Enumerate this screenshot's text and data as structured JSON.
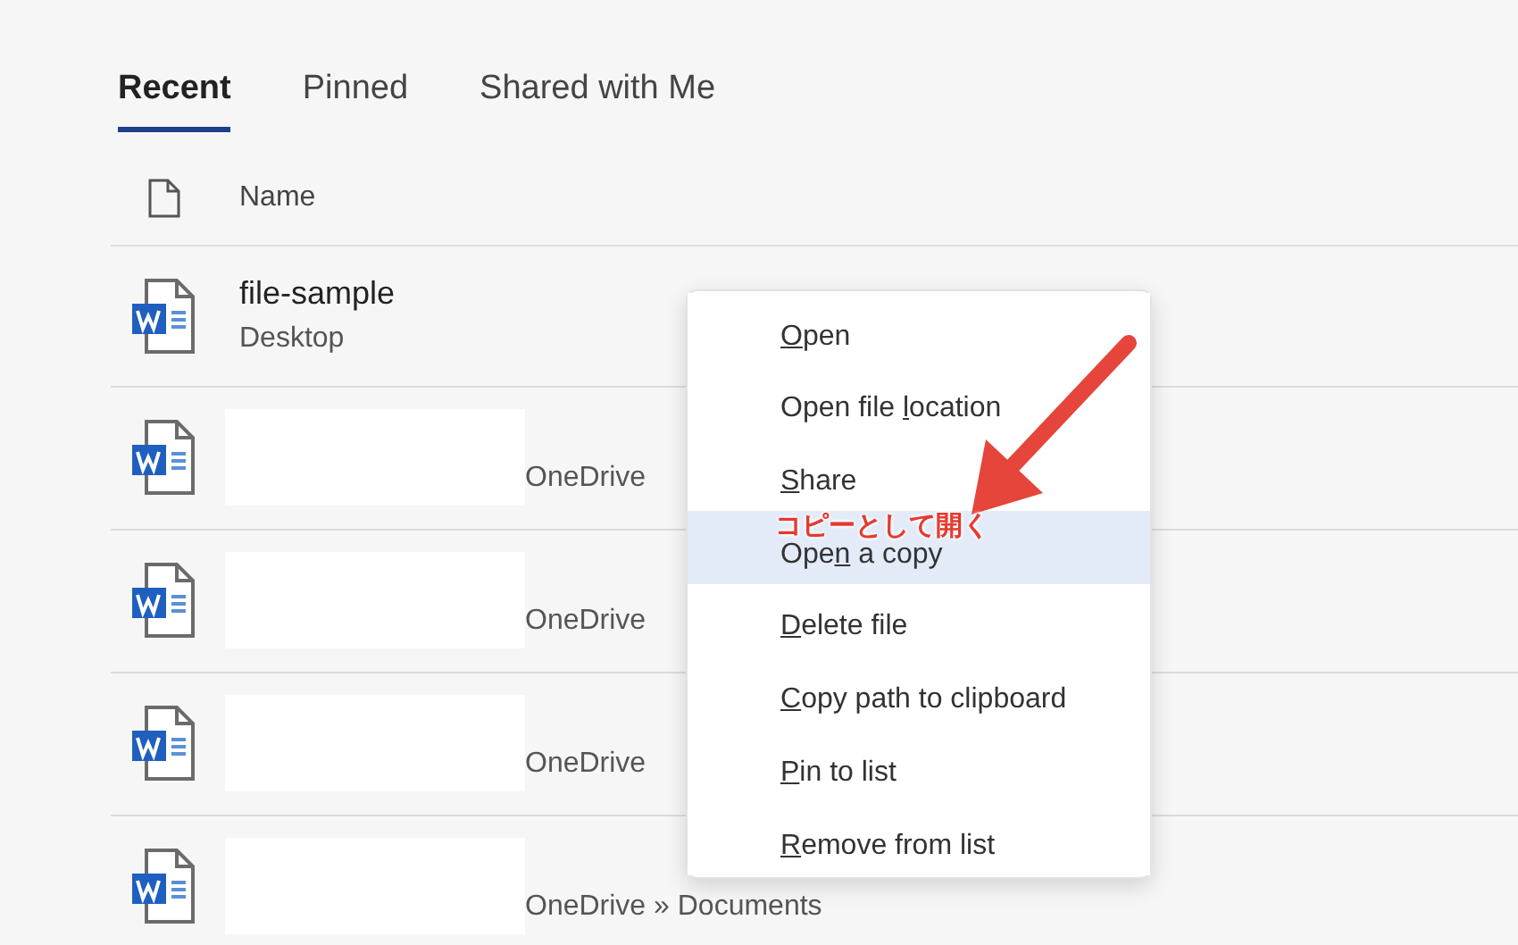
{
  "tabs": [
    {
      "label": "Recent",
      "selected": true
    },
    {
      "label": "Pinned",
      "selected": false
    },
    {
      "label": "Shared with Me",
      "selected": false
    }
  ],
  "table": {
    "columns": [
      {
        "label": "Name"
      }
    ],
    "rows": [
      {
        "kind": "named",
        "name": "file-sample",
        "location": "Desktop"
      },
      {
        "kind": "redacted",
        "location": "OneDrive"
      },
      {
        "kind": "redacted",
        "location": "OneDrive"
      },
      {
        "kind": "redacted",
        "location": "OneDrive"
      },
      {
        "kind": "redacted",
        "location": "OneDrive » Documents"
      }
    ]
  },
  "context_menu": {
    "items": [
      {
        "key": "O",
        "post": "pen",
        "selected": false
      },
      {
        "pre": "Open file ",
        "key": "l",
        "post": "ocation",
        "selected": false
      },
      {
        "key": "S",
        "post": "hare",
        "selected": false
      },
      {
        "pre": "Ope",
        "key": "n",
        "post": " a copy",
        "selected": true
      },
      {
        "key": "D",
        "post": "elete file",
        "selected": false
      },
      {
        "key": "C",
        "post": "opy path to clipboard",
        "selected": false
      },
      {
        "key": "P",
        "post": "in to list",
        "selected": false
      },
      {
        "key": "R",
        "post": "emove from list",
        "selected": false
      }
    ]
  },
  "annotation": {
    "label": "コピーとして開く"
  }
}
